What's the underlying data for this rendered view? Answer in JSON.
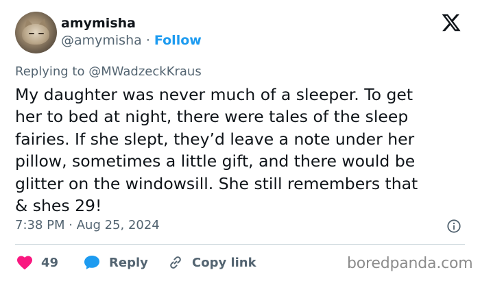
{
  "author": {
    "display_name": "amymisha",
    "handle": "@amymisha",
    "separator": "·",
    "follow_label": "Follow"
  },
  "reply_context": {
    "prefix": "Replying to",
    "mention": "@MWadzeckKraus"
  },
  "tweet": {
    "text": "My daughter was never much of a sleeper. To get\nher to bed at night, there were tales of the sleep\nfairies. If she slept, they’d leave a note under her\npillow, sometimes a little gift, and there would be\nglitter on the windowsill.  She still remembers that\n& shes 29!",
    "time": "7:38 PM",
    "date_separator": "·",
    "date": "Aug 25, 2024"
  },
  "actions": {
    "like_count": "49",
    "reply_label": "Reply",
    "copy_link_label": "Copy link"
  },
  "watermark": "boredpanda.com",
  "icons": {
    "logo": "x-logo-icon",
    "info": "info-icon",
    "like": "heart-icon",
    "reply": "speech-bubble-icon",
    "copy_link": "link-icon"
  },
  "colors": {
    "text": "#0f1419",
    "secondary": "#536471",
    "accent": "#1d9bf0",
    "like": "#f91880",
    "divider": "#cfd9de"
  }
}
